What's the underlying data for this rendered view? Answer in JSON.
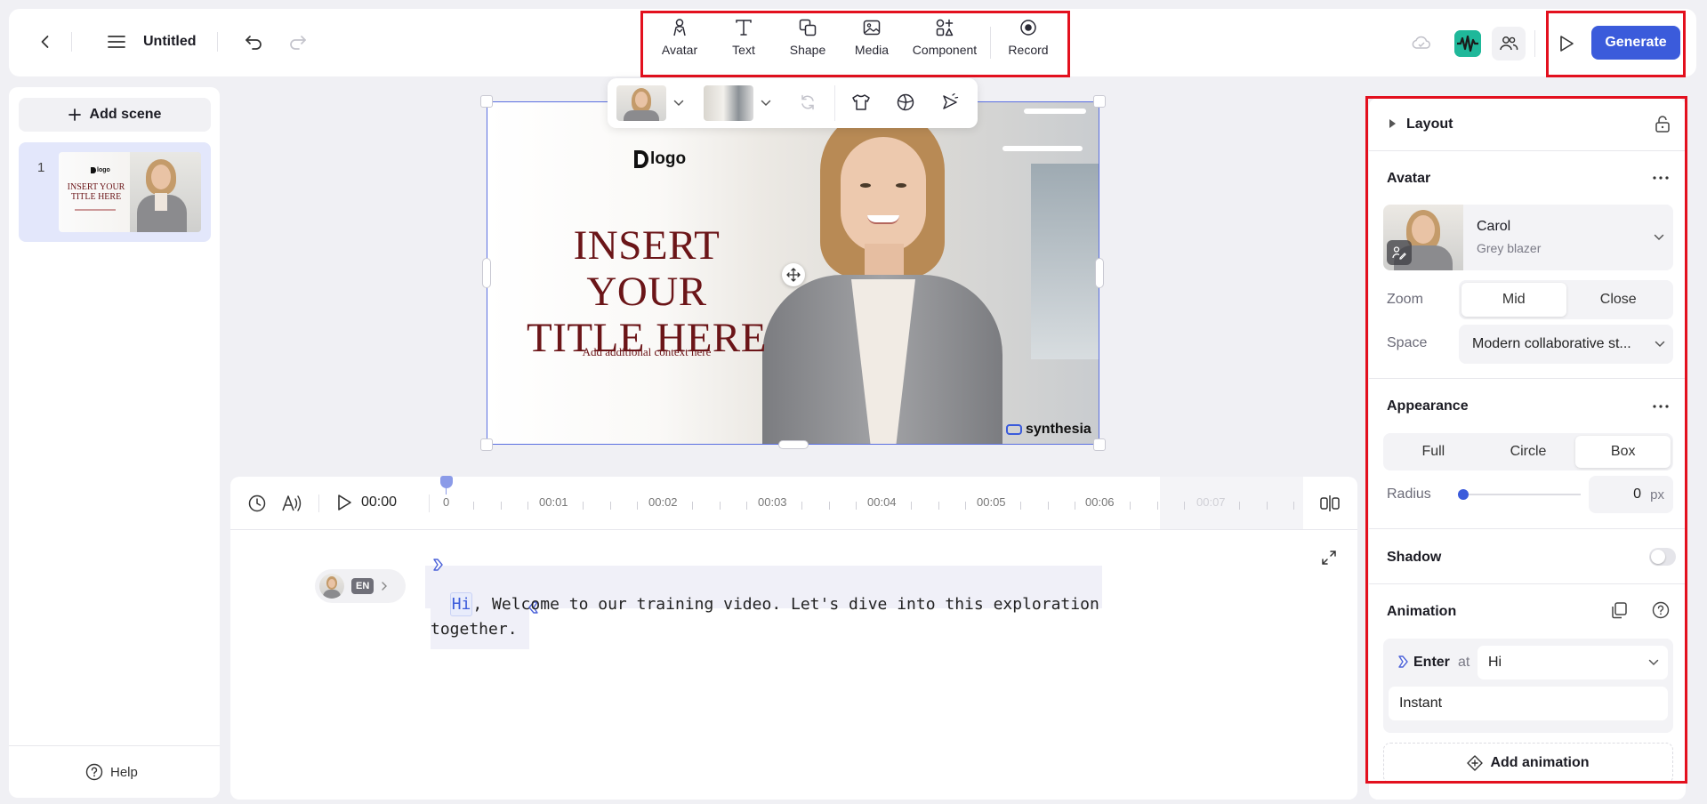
{
  "header": {
    "title": "Untitled",
    "tools": [
      {
        "label": "Avatar",
        "icon": "avatar-icon"
      },
      {
        "label": "Text",
        "icon": "text-icon"
      },
      {
        "label": "Shape",
        "icon": "shape-icon"
      },
      {
        "label": "Media",
        "icon": "media-icon"
      },
      {
        "label": "Component",
        "icon": "component-icon"
      },
      {
        "label": "Record",
        "icon": "record-icon"
      }
    ],
    "generate_label": "Generate"
  },
  "sidebar": {
    "add_scene_label": "Add scene",
    "scenes": [
      {
        "number": "1"
      }
    ],
    "help_label": "Help"
  },
  "canvas": {
    "logo_text": "logo",
    "title_line1": "INSERT YOUR",
    "title_line2": "TITLE HERE",
    "subtitle": "Add additional context here",
    "watermark": "synthesia",
    "title_color": "#6b1518"
  },
  "thumb": {
    "logo_text": "logo",
    "title_line1": "INSERT YOUR",
    "title_line2": "TITLE HERE"
  },
  "timeline": {
    "current_time": "00:00",
    "marks": [
      "0",
      "00:01",
      "00:02",
      "00:03",
      "00:04",
      "00:05",
      "00:06",
      "00:07"
    ]
  },
  "script": {
    "language": "EN",
    "first_word": "Hi",
    "line1_rest": ", Welcome to our training video. Let's dive into this exploration",
    "line2": "together."
  },
  "properties": {
    "layout_label": "Layout",
    "avatar_section": "Avatar",
    "avatar_name": "Carol",
    "avatar_outfit": "Grey blazer",
    "zoom_label": "Zoom",
    "zoom_options": [
      "Mid",
      "Close"
    ],
    "zoom_selected": "Mid",
    "space_label": "Space",
    "space_value": "Modern collaborative st...",
    "appearance_section": "Appearance",
    "appearance_options": [
      "Full",
      "Circle",
      "Box"
    ],
    "appearance_selected": "Box",
    "radius_label": "Radius",
    "radius_value": "0",
    "radius_unit": "px",
    "radius_fraction": 0,
    "shadow_label": "Shadow",
    "shadow_on": false,
    "animation_section": "Animation",
    "enter_label": "Enter",
    "enter_at": "at",
    "enter_trigger": "Hi",
    "enter_style": "Instant",
    "add_animation_label": "Add animation",
    "accent_color": "#3b5bdb"
  }
}
